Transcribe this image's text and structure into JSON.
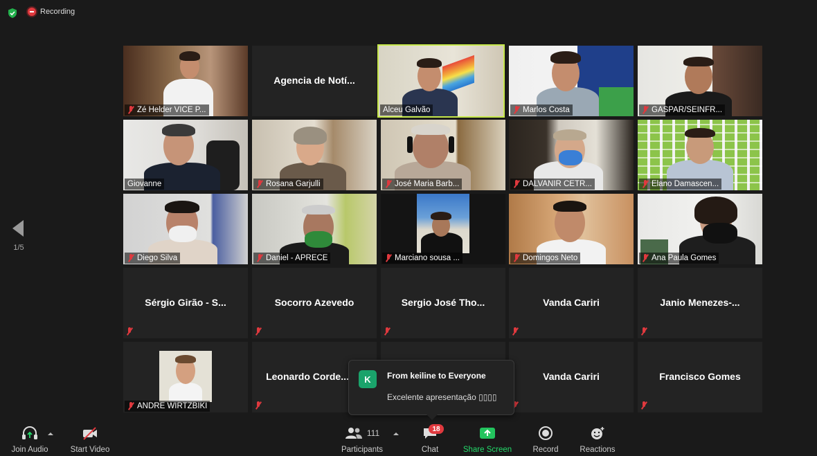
{
  "top_bar": {
    "recording_label": "Recording"
  },
  "page_nav": {
    "indicator": "1/5"
  },
  "tiles": [
    {
      "name": "Zé Helder VICE P...",
      "type": "video"
    },
    {
      "name": "Agencia de Notí...",
      "type": "name"
    },
    {
      "name": "Alceu Galvão",
      "type": "video",
      "active": true
    },
    {
      "name": "Marlos Costa",
      "type": "video"
    },
    {
      "name": "GASPAR/SEINFR...",
      "type": "video"
    },
    {
      "name": "Giovanne",
      "type": "video"
    },
    {
      "name": "Rosana Garjulli",
      "type": "video"
    },
    {
      "name": "José Maria Barb...",
      "type": "video"
    },
    {
      "name": "DALVANIR CETR...",
      "type": "video"
    },
    {
      "name": "Elano Damascen...",
      "type": "video"
    },
    {
      "name": "Diego Silva",
      "type": "video"
    },
    {
      "name": "Daniel - APRECE",
      "type": "video"
    },
    {
      "name": "Marciano sousa ...",
      "type": "video"
    },
    {
      "name": "Domingos Neto",
      "type": "video"
    },
    {
      "name": "Ana Paula Gomes",
      "type": "video"
    },
    {
      "name": "Sérgio Girão  - S...",
      "type": "name"
    },
    {
      "name": "Socorro Azevedo",
      "type": "name"
    },
    {
      "name": "Sergio José Tho...",
      "type": "name"
    },
    {
      "name": "Vanda Cariri",
      "type": "name"
    },
    {
      "name": "Janio  Menezes-...",
      "type": "name"
    },
    {
      "name": "ANDRE WIRTZBIKI",
      "type": "photo"
    },
    {
      "name": "Leonardo  Corde...",
      "type": "name"
    },
    {
      "name": "",
      "type": "name"
    },
    {
      "name": "Vanda  Cariri",
      "type": "name"
    },
    {
      "name": "Francisco Gomes",
      "type": "name"
    }
  ],
  "chat_popup": {
    "avatar_letter": "K",
    "from": "From keiline to Everyone",
    "message": "Excelente apresentação ▯▯▯▯"
  },
  "toolbar": {
    "join_audio": "Join Audio",
    "start_video": "Start Video",
    "participants_count": "111",
    "participants": "Participants",
    "chat_badge": "18",
    "chat": "Chat",
    "share_screen": "Share Screen",
    "record": "Record",
    "reactions": "Reactions"
  },
  "colors": {
    "background": "#1a1a1a",
    "tile": "#232323",
    "active_speaker": "#c6e84a",
    "share_green": "#23d96a",
    "muted_red": "#e0393e"
  }
}
